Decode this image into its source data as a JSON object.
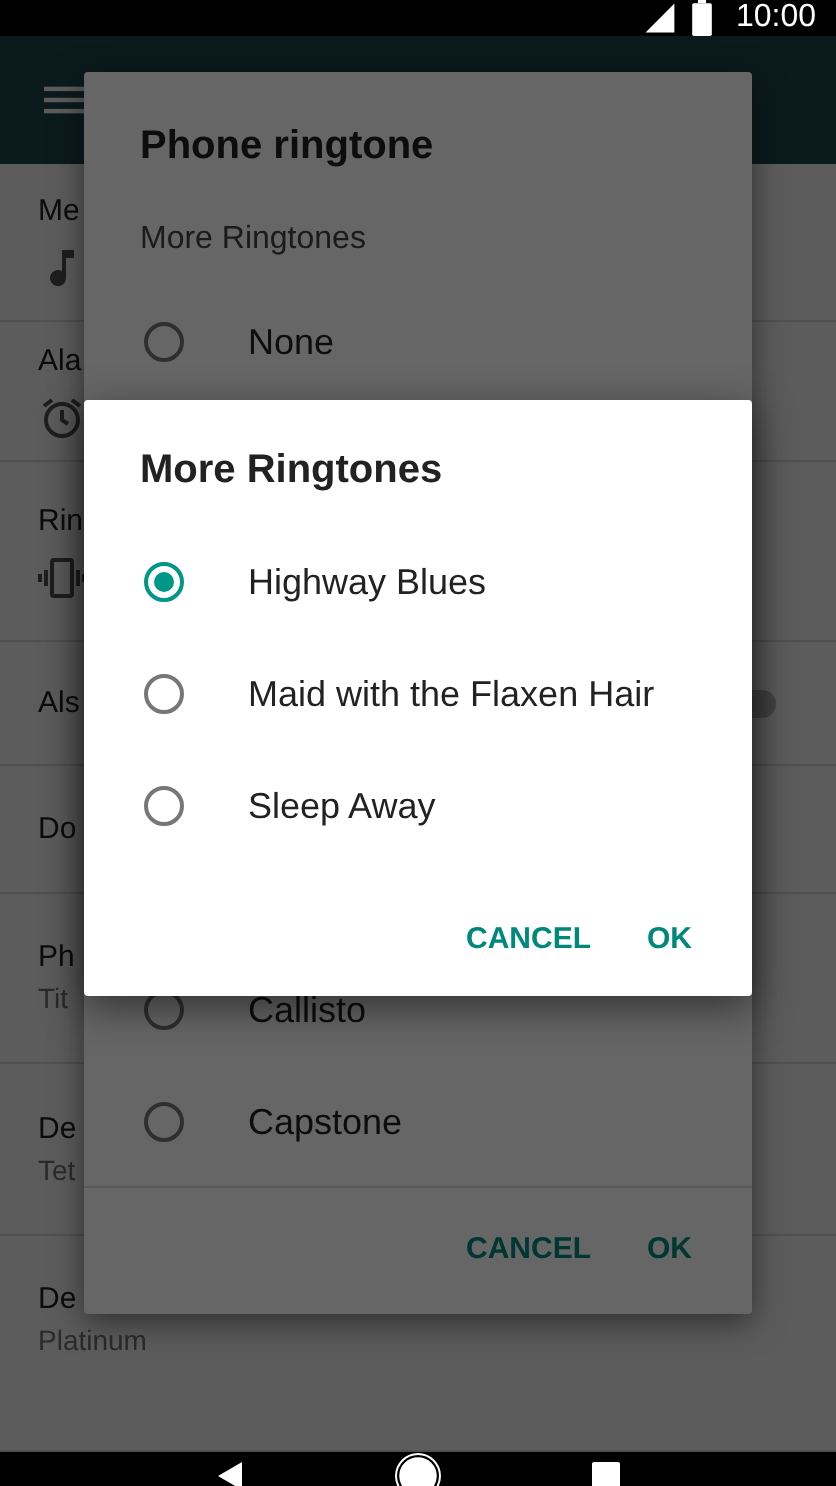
{
  "status_bar": {
    "time": "10:00"
  },
  "settings_list": [
    {
      "kind": "slider",
      "title": "Me"
    },
    {
      "kind": "slider",
      "title": "Ala"
    },
    {
      "kind": "slider",
      "title": "Rin"
    },
    {
      "kind": "switch",
      "title": "Als",
      "on": false
    },
    {
      "kind": "plain",
      "title": "Do"
    },
    {
      "kind": "plain",
      "title": "Ph",
      "subtitle": "Tit"
    },
    {
      "kind": "plain",
      "title": "De",
      "subtitle": "Tet"
    },
    {
      "kind": "plain",
      "title": "De",
      "subtitle": "Platinum"
    }
  ],
  "ringtone_dialog": {
    "title": "Phone ringtone",
    "section": "More Ringtones",
    "options": [
      {
        "label": "None",
        "selected": false
      },
      {
        "label": "Callisto",
        "selected": false
      },
      {
        "label": "Capstone",
        "selected": false
      }
    ],
    "buttons": [
      "CANCEL",
      "OK"
    ]
  },
  "more_dialog": {
    "title": "More Ringtones",
    "options": [
      {
        "label": "Highway Blues",
        "selected": true
      },
      {
        "label": "Maid with the Flaxen Hair",
        "selected": false
      },
      {
        "label": "Sleep Away",
        "selected": false
      }
    ],
    "buttons": [
      "CANCEL",
      "OK"
    ]
  }
}
